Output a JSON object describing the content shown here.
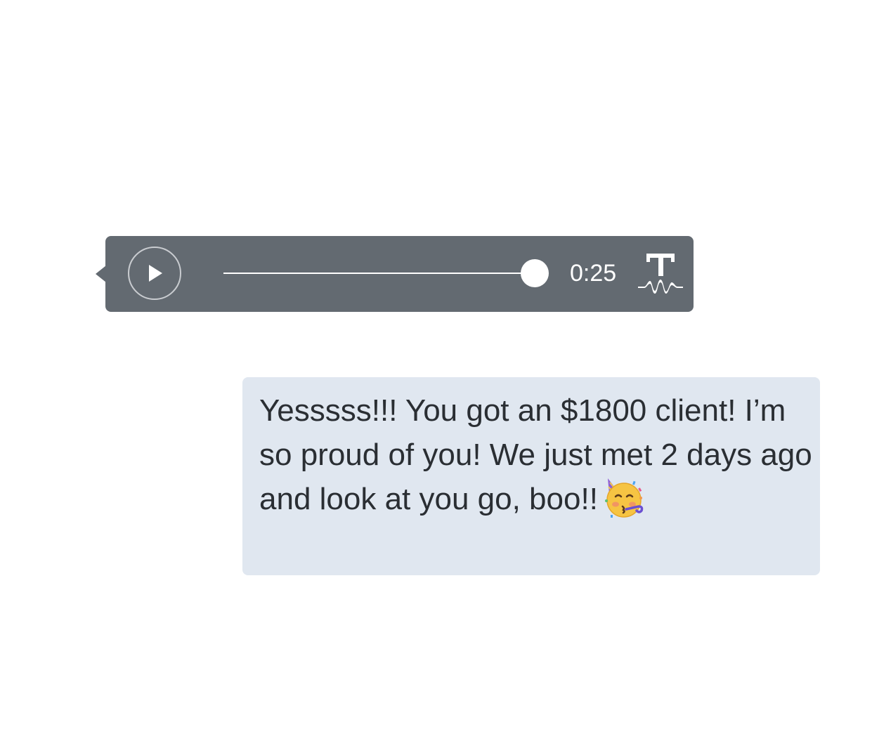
{
  "voice_message": {
    "duration": "0:25",
    "playback_progress": 1.0,
    "play_icon": "play-icon",
    "transcribe_icon": "transcribe-icon",
    "bubble_color": "#636a71"
  },
  "text_message": {
    "text": "Yesssss!!! You got an $1800 client! I’m so proud of you! We just met 2 days ago and look at you go, boo!!",
    "emoji": "🥳",
    "emoji_icon": "partying-face-icon",
    "bubble_color": "#e0e7f0",
    "text_color": "#2a2e33"
  }
}
